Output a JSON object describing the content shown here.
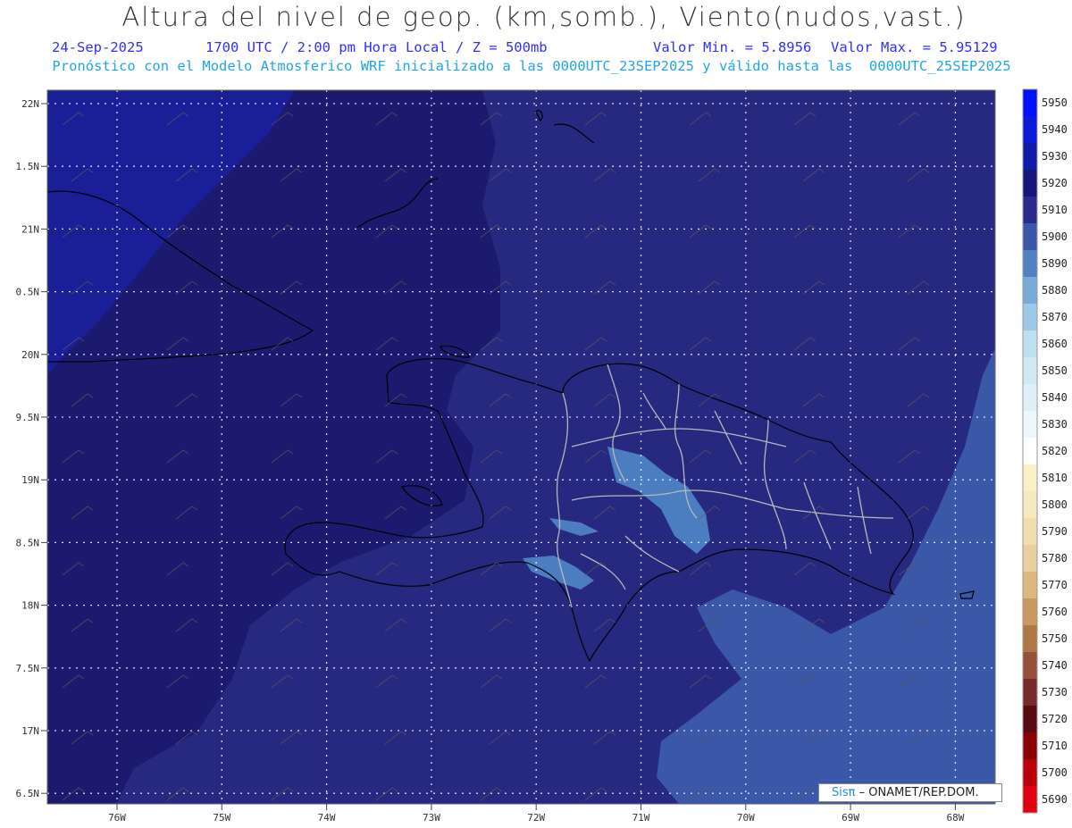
{
  "header": {
    "title": "Altura del nivel de geop. (km,somb.), Viento(nudos,vast.)",
    "date": "24-Sep-2025",
    "time": "1700 UTC / 2:00 pm Hora Local / Z = 500mb",
    "min_label": "Valor Min. = 5.8956",
    "max_label": "Valor Max. = 5.95129",
    "forecast_line": "Pronóstico con el Modelo Atmosferico WRF inicializado a las 0000UTC_23SEP2025 y válido hasta las  0000UTC_25SEP2025"
  },
  "axes": {
    "lat_ticks": [
      "22N",
      "1.5N",
      "21N",
      "0.5N",
      "20N",
      "9.5N",
      "19N",
      "8.5N",
      "18N",
      "7.5N",
      "17N",
      "6.5N"
    ],
    "lon_ticks": [
      "76W",
      "75W",
      "74W",
      "73W",
      "72W",
      "71W",
      "70W",
      "69W",
      "68W"
    ]
  },
  "legend": {
    "levels": [
      "5950",
      "5940",
      "5930",
      "5920",
      "5910",
      "5900",
      "5890",
      "5880",
      "5870",
      "5860",
      "5850",
      "5840",
      "5830",
      "5820",
      "5810",
      "5800",
      "5790",
      "5780",
      "5770",
      "5760",
      "5750",
      "5740",
      "5730",
      "5720",
      "5710",
      "5700",
      "5690"
    ],
    "colors": [
      "#0010ff",
      "#0a1ad8",
      "#101ba8",
      "#15157a",
      "#2b2b8e",
      "#3b58a8",
      "#4f82c0",
      "#7aaad6",
      "#9ec9e6",
      "#bde0f0",
      "#cfe9f5",
      "#dff1f8",
      "#eef8fc",
      "#ffffff",
      "#faf0c8",
      "#f6e8c0",
      "#f1ddb0",
      "#ead0a0",
      "#dcb880",
      "#c89860",
      "#b07848",
      "#964f38",
      "#7a2a2a",
      "#5c0a12",
      "#8a0005",
      "#b80008",
      "#e00010"
    ]
  },
  "credit": {
    "sis": "Sisπ",
    "text": "– ONAMET/REP.DOM."
  },
  "colors": {
    "field_5920": "#1c1a6e",
    "field_5910": "#27287f",
    "field_5930": "#1a1e96",
    "field_5900": "#3b58a8",
    "field_5890": "#4b7ec0",
    "coast": "#000000",
    "provinces": "#bbbbbb",
    "grid": "#ffffff"
  }
}
